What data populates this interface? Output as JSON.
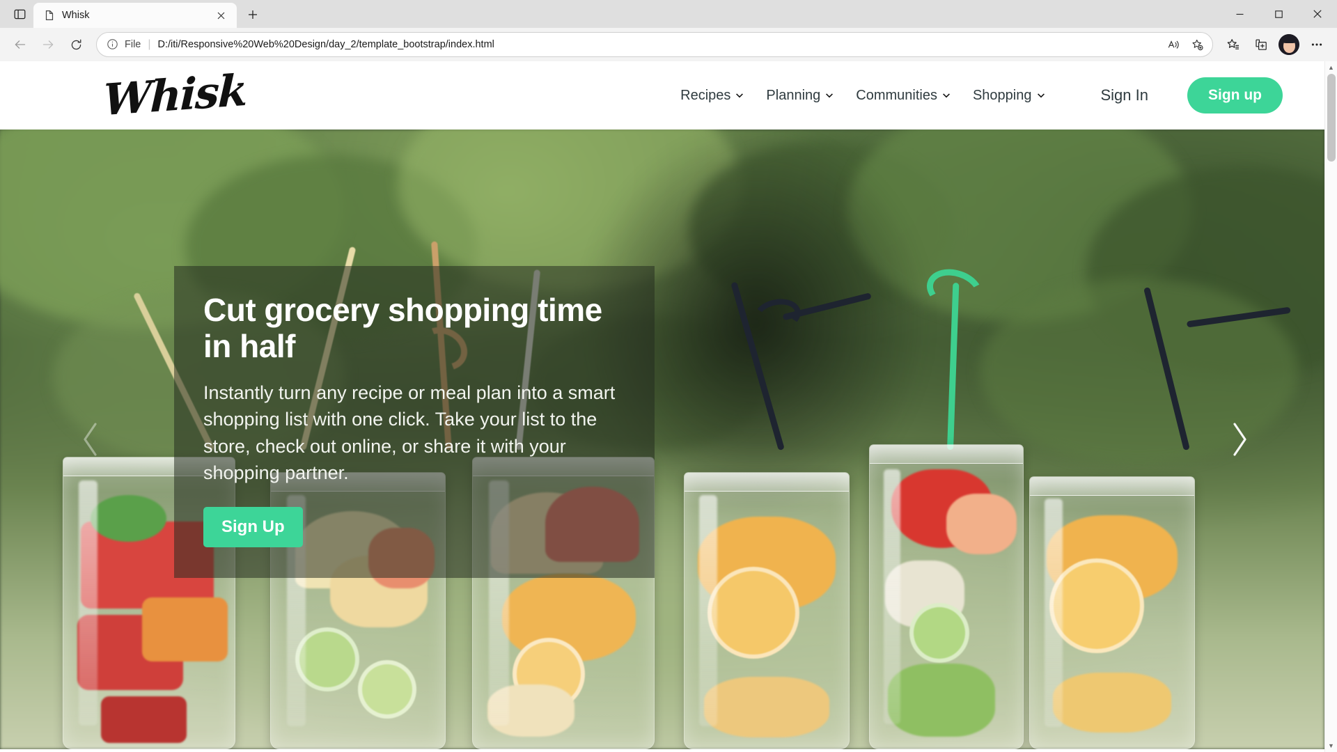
{
  "browser": {
    "tab": {
      "title": "Whisk",
      "favicon_icon": "page-icon",
      "close_icon": "close-icon"
    },
    "tab_search_icon": "tab-search-icon",
    "new_tab_icon": "plus-icon",
    "window": {
      "minimize_icon": "minimize-icon",
      "maximize_icon": "maximize-icon",
      "close_icon": "window-close-icon"
    },
    "toolbar": {
      "back_icon": "back-arrow-icon",
      "forward_icon": "forward-arrow-icon",
      "refresh_icon": "refresh-icon",
      "info_icon": "info-circle-icon",
      "scheme_label": "File",
      "url": "D:/iti/Responsive%20Web%20Design/day_2/template_bootstrap/index.html",
      "read_aloud_icon": "read-aloud-icon",
      "add_favorite_icon": "add-favorite-star-icon",
      "favorites_icon": "favorites-star-icon",
      "collections_icon": "collections-icon",
      "profile_icon": "profile-avatar-icon",
      "settings_icon": "ellipsis-icon"
    }
  },
  "site": {
    "logo": "Whisk",
    "nav": [
      {
        "label": "Recipes",
        "caret": "❯"
      },
      {
        "label": "Planning",
        "caret": "❯"
      },
      {
        "label": "Communities",
        "caret": "❯"
      },
      {
        "label": "Shopping",
        "caret": "❯"
      }
    ],
    "sign_in_label": "Sign In",
    "sign_up_label": "Sign up",
    "accent_color": "#3dd598"
  },
  "hero": {
    "title": "Cut grocery shopping time in half",
    "subtitle": "Instantly turn any recipe or meal plan into a smart shopping list with one click. Take your list to the store, check out online, or share it with your shopping partner.",
    "cta_label": "Sign Up",
    "prev_icon": "chevron-left-icon",
    "next_icon": "chevron-right-icon",
    "overlay_color": "rgba(35,42,30,.52)"
  },
  "scrollbar": {
    "up_icon": "scroll-up-icon",
    "down_icon": "scroll-down-icon"
  }
}
